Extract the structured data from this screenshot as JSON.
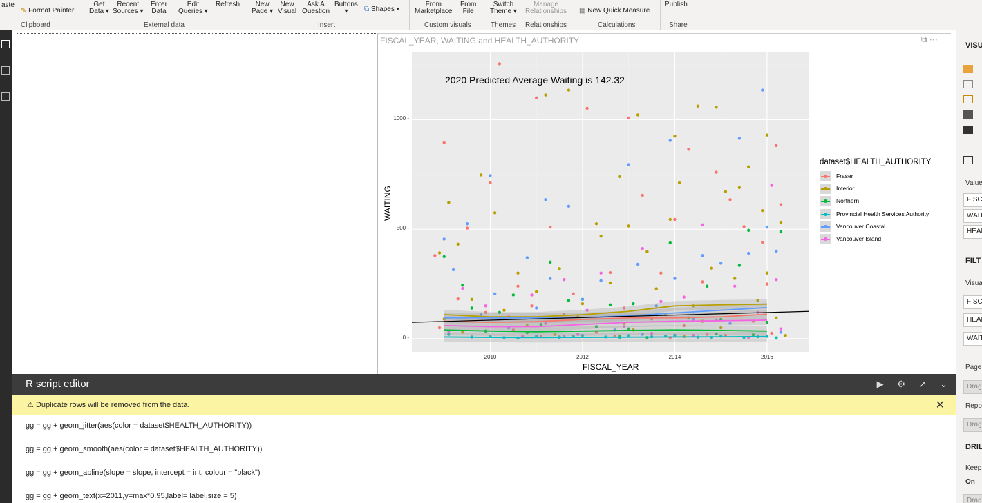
{
  "ribbon": {
    "buttons": [
      {
        "l1": "aste",
        "l2": ""
      },
      {
        "l1": "Format Painter",
        "l2": ""
      },
      {
        "l1": "Get",
        "l2": "Data ▾"
      },
      {
        "l1": "Recent",
        "l2": "Sources ▾"
      },
      {
        "l1": "Enter",
        "l2": "Data"
      },
      {
        "l1": "Edit",
        "l2": "Queries ▾"
      },
      {
        "l1": "Refresh",
        "l2": ""
      },
      {
        "l1": "New",
        "l2": "Page ▾"
      },
      {
        "l1": "New",
        "l2": "Visual"
      },
      {
        "l1": "Ask A",
        "l2": "Question"
      },
      {
        "l1": "Buttons",
        "l2": "▾"
      },
      {
        "l1": "Shapes ▾",
        "l2": ""
      },
      {
        "l1": "From",
        "l2": "Marketplace"
      },
      {
        "l1": "From",
        "l2": "File"
      },
      {
        "l1": "Switch",
        "l2": "Theme ▾"
      },
      {
        "l1": "Manage",
        "l2": "Relationships"
      },
      {
        "l1": "New Quick Measure",
        "l2": ""
      },
      {
        "l1": "Publish",
        "l2": ""
      }
    ],
    "groups": [
      "Clipboard",
      "External data",
      "Insert",
      "Custom visuals",
      "Themes",
      "Relationships",
      "Calculations",
      "Share"
    ]
  },
  "visual": {
    "title": "FISCAL_YEAR, WAITING and HEALTH_AUTHORITY",
    "menu": "⋯"
  },
  "chart_data": {
    "type": "scatter",
    "title": "2020 Predicted Average Waiting is 142.32",
    "xlabel": "FISCAL_YEAR",
    "ylabel": "WAITING",
    "xlim": [
      2008.3,
      2016.9
    ],
    "ylim": [
      -60,
      1310
    ],
    "xticks": [
      2010,
      2012,
      2014,
      2016
    ],
    "yticks": [
      0,
      500,
      1000
    ],
    "grid": true,
    "legend_title": "dataset$HEALTH_AUTHORITY",
    "legend_position": "right",
    "series": [
      {
        "name": "Fraser",
        "color": "#F8766D",
        "points": [
          [
            2009.0,
            895
          ],
          [
            2010.2,
            1255
          ],
          [
            2010.0,
            712
          ],
          [
            2009.5,
            505
          ],
          [
            2011.0,
            1100
          ],
          [
            2011.3,
            510
          ],
          [
            2012.1,
            1052
          ],
          [
            2013.0,
            1008
          ],
          [
            2013.3,
            655
          ],
          [
            2014.0,
            545
          ],
          [
            2014.3,
            865
          ],
          [
            2014.9,
            760
          ],
          [
            2015.2,
            635
          ],
          [
            2015.5,
            512
          ],
          [
            2016.2,
            882
          ],
          [
            2016.3,
            612
          ],
          [
            2015.9,
            440
          ],
          [
            2010.6,
            240
          ],
          [
            2012.6,
            302
          ],
          [
            2013.7,
            300
          ],
          [
            2011.8,
            205
          ],
          [
            2009.3,
            182
          ],
          [
            2008.8,
            380
          ],
          [
            2014.6,
            260
          ],
          [
            2016.0,
            250
          ],
          [
            2010.9,
            150
          ],
          [
            2012.9,
            140
          ],
          [
            2009.9,
            120
          ],
          [
            2011.6,
            110
          ],
          [
            2013.5,
            90
          ],
          [
            2015.7,
            80
          ],
          [
            2014.2,
            60
          ],
          [
            2008.9,
            50
          ],
          [
            2010.5,
            40
          ],
          [
            2012.3,
            30
          ],
          [
            2016.1,
            25
          ],
          [
            2015.1,
            15
          ],
          [
            2011.1,
            10
          ],
          [
            2013.9,
            5
          ],
          [
            2009.6,
            8
          ],
          [
            2012.7,
            12
          ],
          [
            2014.7,
            20
          ]
        ]
      },
      {
        "name": "Interior",
        "color": "#B79F00",
        "points": [
          [
            2011.2,
            1113
          ],
          [
            2011.7,
            1135
          ],
          [
            2013.2,
            1022
          ],
          [
            2014.5,
            1062
          ],
          [
            2014.9,
            1057
          ],
          [
            2009.1,
            622
          ],
          [
            2009.8,
            748
          ],
          [
            2012.3,
            525
          ],
          [
            2012.8,
            740
          ],
          [
            2014.1,
            712
          ],
          [
            2014.0,
            925
          ],
          [
            2015.1,
            672
          ],
          [
            2015.4,
            690
          ],
          [
            2015.6,
            785
          ],
          [
            2016.0,
            930
          ],
          [
            2015.9,
            585
          ],
          [
            2016.3,
            530
          ],
          [
            2013.9,
            545
          ],
          [
            2013.0,
            515
          ],
          [
            2010.1,
            575
          ],
          [
            2009.3,
            432
          ],
          [
            2008.9,
            392
          ],
          [
            2010.6,
            300
          ],
          [
            2011.5,
            320
          ],
          [
            2012.6,
            255
          ],
          [
            2013.6,
            228
          ],
          [
            2014.8,
            322
          ],
          [
            2015.3,
            275
          ],
          [
            2016.0,
            300
          ],
          [
            2012.4,
            468
          ],
          [
            2013.4,
            398
          ],
          [
            2011.0,
            215
          ],
          [
            2009.6,
            180
          ],
          [
            2012.0,
            160
          ],
          [
            2014.4,
            150
          ],
          [
            2015.8,
            175
          ],
          [
            2010.3,
            130
          ],
          [
            2013.8,
            110
          ],
          [
            2011.9,
            100
          ],
          [
            2009.0,
            90
          ],
          [
            2016.2,
            95
          ],
          [
            2014.6,
            80
          ],
          [
            2012.9,
            70
          ],
          [
            2010.8,
            60
          ],
          [
            2015.0,
            50
          ],
          [
            2013.1,
            40
          ],
          [
            2009.4,
            30
          ],
          [
            2011.4,
            20
          ],
          [
            2016.4,
            15
          ],
          [
            2014.2,
            10
          ]
        ]
      },
      {
        "name": "Northern",
        "color": "#00BA38",
        "points": [
          [
            2009.0,
            375
          ],
          [
            2009.4,
            245
          ],
          [
            2011.3,
            350
          ],
          [
            2013.9,
            438
          ],
          [
            2015.6,
            495
          ],
          [
            2016.3,
            488
          ],
          [
            2010.5,
            200
          ],
          [
            2012.0,
            180
          ],
          [
            2013.1,
            160
          ],
          [
            2014.7,
            240
          ],
          [
            2015.4,
            335
          ],
          [
            2011.7,
            175
          ],
          [
            2012.6,
            155
          ],
          [
            2009.6,
            140
          ],
          [
            2010.2,
            120
          ],
          [
            2013.6,
            110
          ],
          [
            2014.3,
            95
          ],
          [
            2015.0,
            88
          ],
          [
            2016.0,
            75
          ],
          [
            2011.1,
            65
          ],
          [
            2012.3,
            55
          ],
          [
            2013.0,
            45
          ],
          [
            2009.9,
            35
          ],
          [
            2010.8,
            28
          ],
          [
            2014.9,
            22
          ],
          [
            2015.7,
            18
          ],
          [
            2012.8,
            12
          ],
          [
            2011.5,
            8
          ],
          [
            2013.4,
            5
          ],
          [
            2016.2,
            3
          ]
        ]
      },
      {
        "name": "Provincial Health Services Authority",
        "color": "#00BFC4",
        "points": [
          [
            2010.0,
            10
          ],
          [
            2010.3,
            5
          ],
          [
            2011.0,
            12
          ],
          [
            2011.5,
            6
          ],
          [
            2012.0,
            15
          ],
          [
            2012.5,
            8
          ],
          [
            2013.0,
            14
          ],
          [
            2013.5,
            9
          ],
          [
            2014.0,
            16
          ],
          [
            2014.5,
            7
          ],
          [
            2015.0,
            12
          ],
          [
            2015.5,
            6
          ],
          [
            2016.0,
            11
          ],
          [
            2016.2,
            4
          ],
          [
            2009.1,
            20
          ],
          [
            2009.6,
            8
          ],
          [
            2010.6,
            3
          ],
          [
            2011.8,
            10
          ],
          [
            2012.8,
            4
          ],
          [
            2013.8,
            12
          ],
          [
            2014.8,
            6
          ],
          [
            2015.8,
            9
          ]
        ]
      },
      {
        "name": "Vancouver Coastal",
        "color": "#619CFF",
        "points": [
          [
            2009.0,
            455
          ],
          [
            2009.5,
            525
          ],
          [
            2010.0,
            745
          ],
          [
            2011.2,
            635
          ],
          [
            2011.7,
            605
          ],
          [
            2013.0,
            795
          ],
          [
            2013.9,
            905
          ],
          [
            2015.4,
            915
          ],
          [
            2015.9,
            1135
          ],
          [
            2015.6,
            390
          ],
          [
            2016.2,
            400
          ],
          [
            2014.6,
            380
          ],
          [
            2013.2,
            340
          ],
          [
            2012.4,
            265
          ],
          [
            2011.3,
            275
          ],
          [
            2010.8,
            370
          ],
          [
            2010.1,
            205
          ],
          [
            2009.2,
            315
          ],
          [
            2014.0,
            275
          ],
          [
            2015.0,
            345
          ],
          [
            2016.0,
            510
          ],
          [
            2012.0,
            180
          ],
          [
            2013.6,
            150
          ],
          [
            2011.0,
            140
          ],
          [
            2009.8,
            110
          ],
          [
            2014.4,
            90
          ],
          [
            2015.2,
            70
          ],
          [
            2010.4,
            50
          ],
          [
            2012.7,
            40
          ],
          [
            2016.3,
            30
          ],
          [
            2013.3,
            20
          ],
          [
            2011.6,
            10
          ]
        ]
      },
      {
        "name": "Vancouver Island",
        "color": "#F564E3",
        "points": [
          [
            2014.6,
            520
          ],
          [
            2016.1,
            700
          ],
          [
            2013.3,
            412
          ],
          [
            2016.2,
            270
          ],
          [
            2009.4,
            230
          ],
          [
            2011.6,
            270
          ],
          [
            2012.4,
            300
          ],
          [
            2010.9,
            200
          ],
          [
            2014.2,
            190
          ],
          [
            2015.3,
            240
          ],
          [
            2013.7,
            170
          ],
          [
            2009.9,
            150
          ],
          [
            2012.1,
            130
          ],
          [
            2015.8,
            120
          ],
          [
            2010.4,
            100
          ],
          [
            2014.9,
            85
          ],
          [
            2011.2,
            70
          ],
          [
            2012.9,
            55
          ],
          [
            2016.3,
            45
          ],
          [
            2009.1,
            35
          ],
          [
            2013.5,
            25
          ],
          [
            2014.4,
            15
          ],
          [
            2010.7,
            10
          ],
          [
            2015.6,
            5
          ],
          [
            2011.9,
            20
          ]
        ]
      }
    ],
    "smooth_bands": [
      {
        "name": "Interior",
        "color": "#B79F00",
        "x": [
          2009,
          2010,
          2011,
          2012,
          2013,
          2014,
          2015,
          2016
        ],
        "y": [
          110,
          100,
          100,
          110,
          125,
          150,
          155,
          158
        ]
      },
      {
        "name": "Vancouver Coastal",
        "color": "#619CFF",
        "x": [
          2009,
          2010,
          2011,
          2012,
          2013,
          2014,
          2015,
          2016
        ],
        "y": [
          95,
          95,
          95,
          97,
          105,
          118,
          130,
          142
        ]
      },
      {
        "name": "Fraser",
        "color": "#F8766D",
        "x": [
          2009,
          2010,
          2011,
          2012,
          2013,
          2014,
          2015,
          2016
        ],
        "y": [
          80,
          75,
          78,
          88,
          95,
          95,
          100,
          112
        ]
      },
      {
        "name": "Vancouver Island",
        "color": "#F564E3",
        "x": [
          2009,
          2010,
          2011,
          2012,
          2013,
          2014,
          2015,
          2016
        ],
        "y": [
          60,
          55,
          55,
          65,
          75,
          80,
          82,
          85
        ]
      },
      {
        "name": "Northern",
        "color": "#00BA38",
        "x": [
          2009,
          2010,
          2011,
          2012,
          2013,
          2014,
          2015,
          2016
        ],
        "y": [
          40,
          35,
          32,
          35,
          38,
          40,
          38,
          35
        ]
      },
      {
        "name": "Provincial Health Services Authority",
        "color": "#00BFC4",
        "x": [
          2009,
          2010,
          2011,
          2012,
          2013,
          2014,
          2015,
          2016
        ],
        "y": [
          8,
          6,
          5,
          6,
          7,
          8,
          9,
          10
        ]
      }
    ],
    "abline": {
      "color": "#000000",
      "x": [
        2008.3,
        2016.9
      ],
      "y": [
        75,
        125
      ]
    }
  },
  "right_panel": {
    "visualizations": "VISU",
    "values": "Value",
    "fields": [
      "FISCA",
      "WAIT",
      "HEAL"
    ],
    "filters": "FILT",
    "visual_level": "Visua",
    "filter_fields": [
      "FISC",
      "HEAL",
      "WAIT"
    ],
    "page": "Page",
    "page_drag": "Drag",
    "report": "Repo",
    "report_drag": "Drag",
    "drill": "DRIL",
    "keep": "Keep",
    "on": "On",
    "drill_drag": "Drag"
  },
  "r_editor": {
    "title": "R script editor",
    "warning": "Duplicate rows will be removed from the data.",
    "code_lines": [
      "gg = gg + geom_jitter(aes(color = dataset$HEALTH_AUTHORITY))",
      "gg = gg + geom_smooth(aes(color = dataset$HEALTH_AUTHORITY))",
      "gg = gg + geom_abline(slope = slope, intercept = int, colour = \"black\")",
      "gg = gg + geom_text(x=2011,y=max*0.95,label= label,size = 5)"
    ]
  }
}
